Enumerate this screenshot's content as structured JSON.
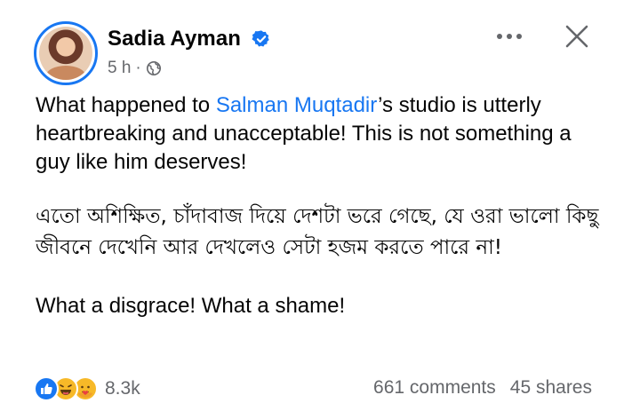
{
  "post": {
    "author": "Sadia Ayman",
    "verified": true,
    "timestamp": "5 h",
    "separator": "·",
    "audience_icon": "globe-icon",
    "paragraphs": {
      "p1_before": "What happened to ",
      "p1_mention": "Salman Muqtadir",
      "p1_after": "’s studio is utterly heartbreaking and unacceptable! This is not something a guy like him deserves!",
      "p2": "এতো অশিক্ষিত, চাঁদাবাজ দিয়ে দেশটা ভরে গেছে, যে ওরা ভালো কিছু জীবনে দেখেনি আর দেখলেও সেটা হজম করতে পারে না!",
      "p3": "What a disgrace! What a shame!"
    }
  },
  "footer": {
    "reaction_icons": [
      "like-icon",
      "haha-icon",
      "care-icon"
    ],
    "reaction_count": "8.3k",
    "comments": "661 comments",
    "shares": "45 shares"
  },
  "colors": {
    "accent": "#1877f2",
    "secondary_text": "#65676b",
    "primary_text": "#050505"
  }
}
